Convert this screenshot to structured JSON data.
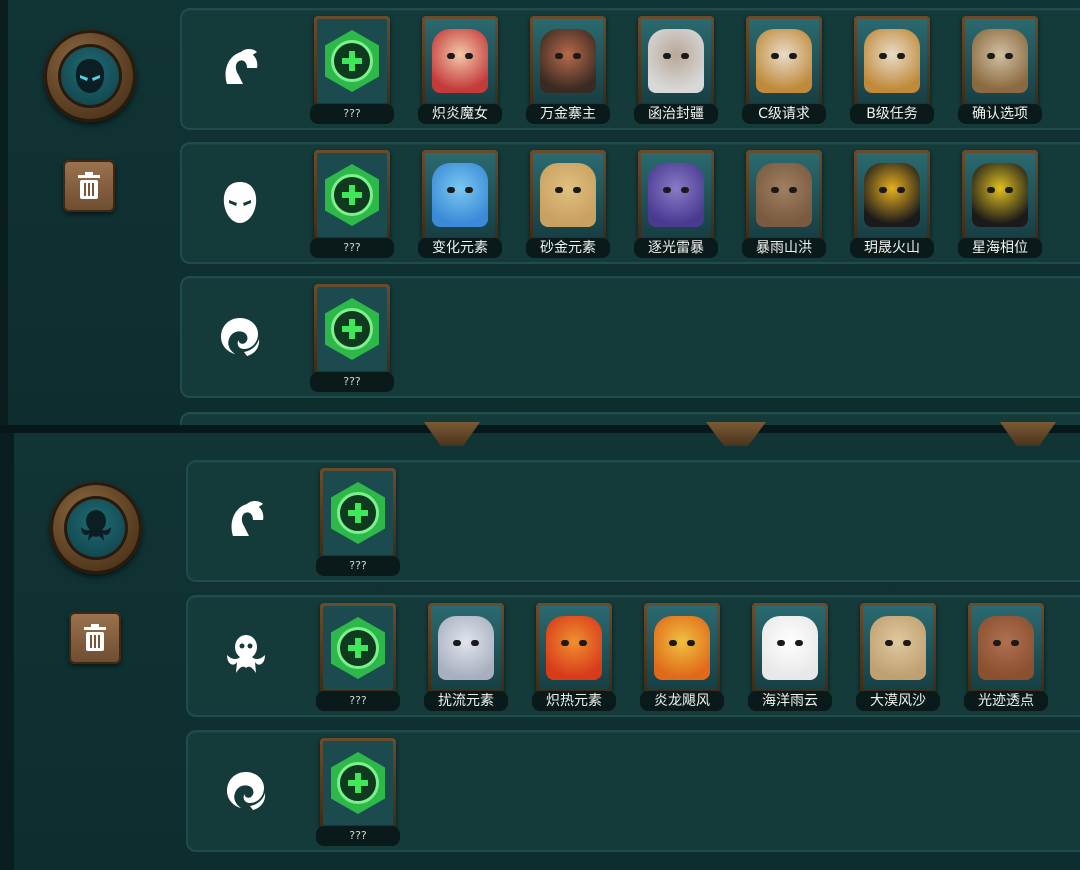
{
  "empty_label": "???",
  "colors": {
    "add_accent": "#2fb84a",
    "frame": "#6b4d2c",
    "panel_bg": "#113434"
  },
  "panels": [
    {
      "emblem_icon": "masked-assassin-icon",
      "trash_icon": "trash-icon",
      "rows": [
        {
          "type_icon": "spartan-helmet-icon",
          "cards": [
            {
              "label": "???",
              "art": "add-hero-slot"
            },
            {
              "label": "炽炎魔女",
              "art": "red-haired-witch-portrait"
            },
            {
              "label": "万金寨主",
              "art": "pirate-captain-portrait"
            },
            {
              "label": "函治封疆",
              "art": "old-eyepatch-wizard-portrait"
            },
            {
              "label": "C级请求",
              "art": "totem-mask-portrait"
            },
            {
              "label": "B级任务",
              "art": "totem-mask-portrait"
            },
            {
              "label": "确认选项",
              "art": "scarecrow-target-portrait"
            }
          ]
        },
        {
          "type_icon": "hooded-mask-icon",
          "cards": [
            {
              "label": "???",
              "art": "add-hero-slot"
            },
            {
              "label": "变化元素",
              "art": "water-elemental-portrait"
            },
            {
              "label": "砂金元素",
              "art": "sand-elemental-portrait"
            },
            {
              "label": "逐光雷暴",
              "art": "storm-elemental-portrait"
            },
            {
              "label": "暴雨山洪",
              "art": "mud-elemental-portrait"
            },
            {
              "label": "玥晟火山",
              "art": "volcano-elemental-portrait"
            },
            {
              "label": "星海相位",
              "art": "black-dragon-portrait"
            }
          ]
        },
        {
          "type_icon": "swirl-icon",
          "cards": [
            {
              "label": "???",
              "art": "add-hero-slot"
            }
          ]
        }
      ]
    },
    {
      "emblem_icon": "kraken-icon",
      "trash_icon": "trash-icon",
      "rows": [
        {
          "type_icon": "spartan-helmet-icon",
          "cards": [
            {
              "label": "???",
              "art": "add-hero-slot"
            }
          ]
        },
        {
          "type_icon": "kraken-icon",
          "cards": [
            {
              "label": "???",
              "art": "add-hero-slot"
            },
            {
              "label": "扰流元素",
              "art": "wind-elemental-portrait"
            },
            {
              "label": "炽热元素",
              "art": "fire-elemental-portrait"
            },
            {
              "label": "炎龙飓风",
              "art": "fire-tornado-portrait"
            },
            {
              "label": "海洋雨云",
              "art": "cloud-elemental-portrait"
            },
            {
              "label": "大漠风沙",
              "art": "sandstorm-elemental-portrait"
            },
            {
              "label": "光迹透点",
              "art": "brown-dragon-portrait"
            }
          ]
        },
        {
          "type_icon": "swirl-icon",
          "cards": [
            {
              "label": "???",
              "art": "add-hero-slot"
            }
          ]
        }
      ]
    }
  ]
}
